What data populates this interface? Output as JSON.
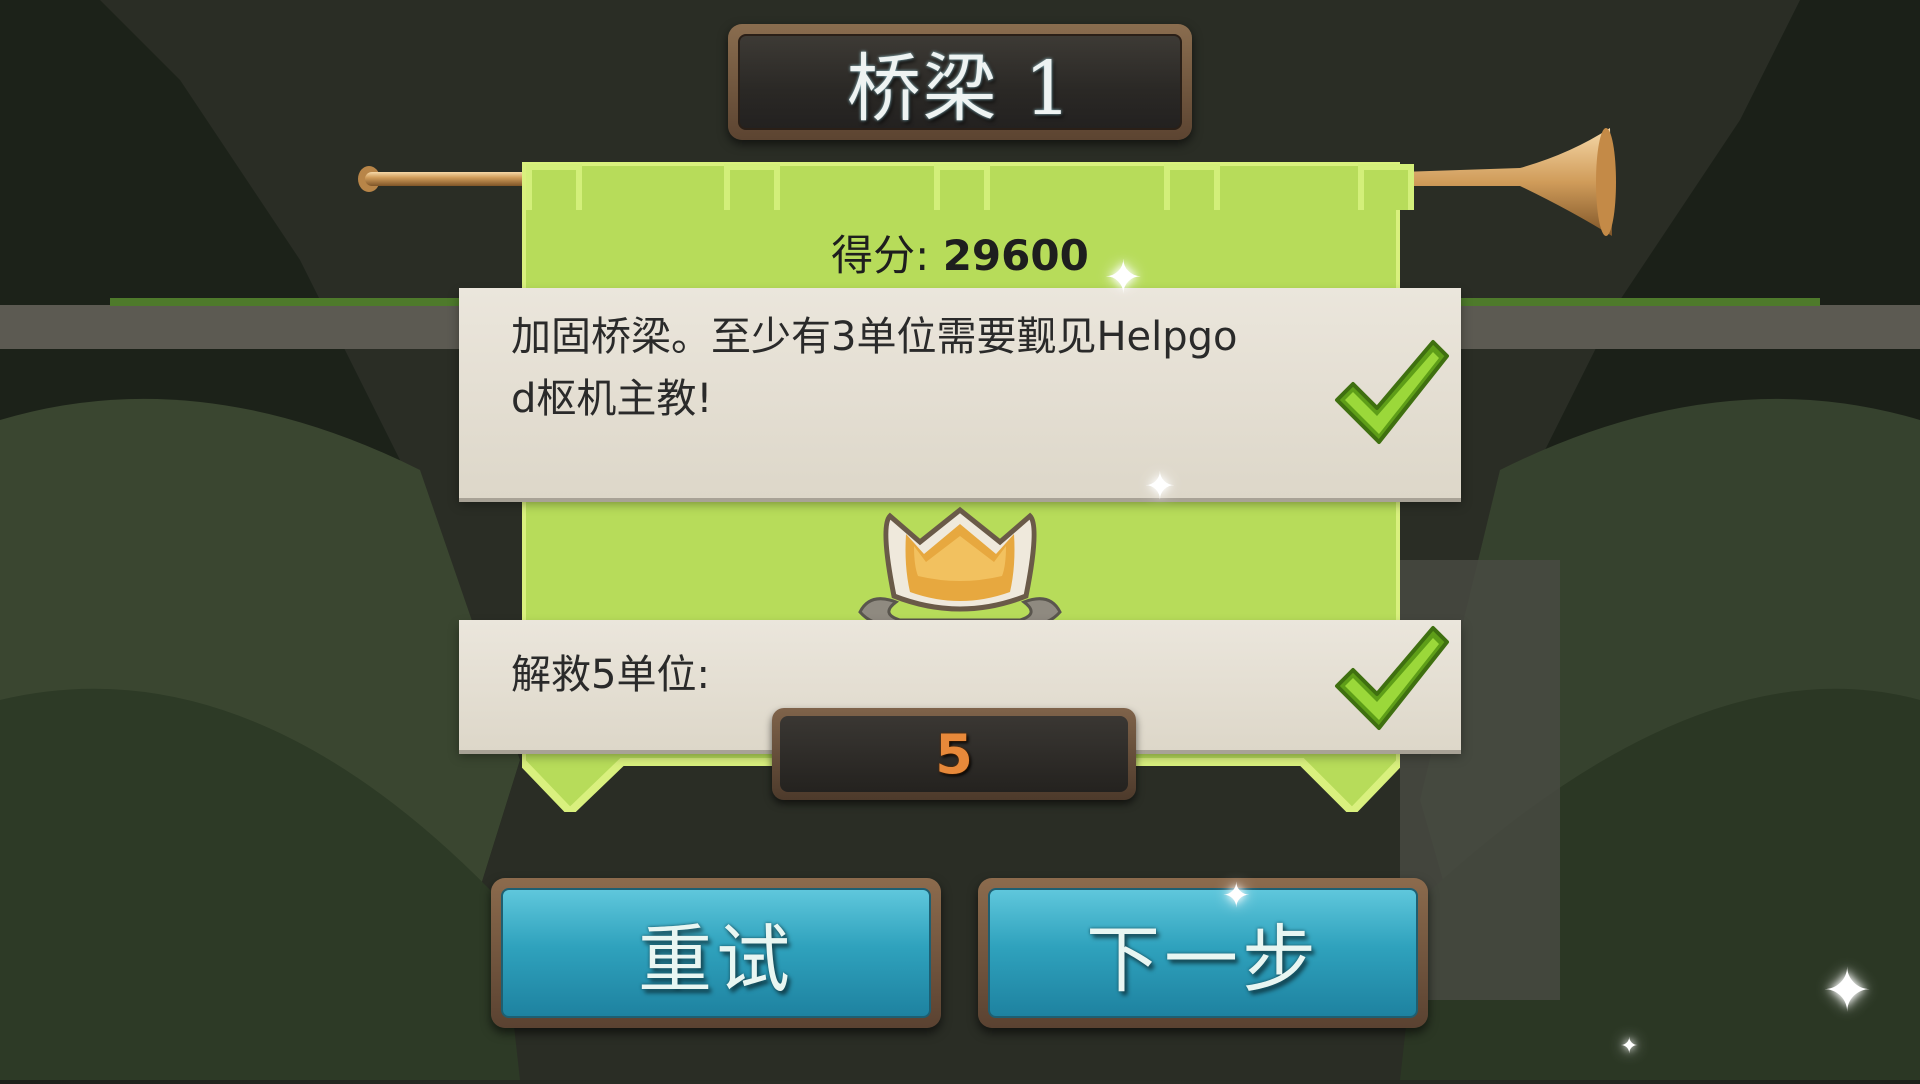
{
  "title": "桥梁 1",
  "score": {
    "label": "得分:",
    "value": "29600"
  },
  "objectives": [
    {
      "text_line1": "加固桥梁。至少有3单位需要觐见Helpgo",
      "text_line2": "d枢机主教!",
      "completed": true
    },
    {
      "text": "解救5单位:",
      "completed": true,
      "count": "5"
    }
  ],
  "buttons": {
    "retry": "重试",
    "next": "下一步"
  },
  "colors": {
    "banner": "#b7dc5a",
    "parchment": "#e6e1d6",
    "button": "#2fa2bd",
    "check": "#7dc21e",
    "count": "#e8893a"
  },
  "icons": [
    "trumpet-icon",
    "crown-icon",
    "checkmark-icon",
    "sparkle-icon"
  ]
}
